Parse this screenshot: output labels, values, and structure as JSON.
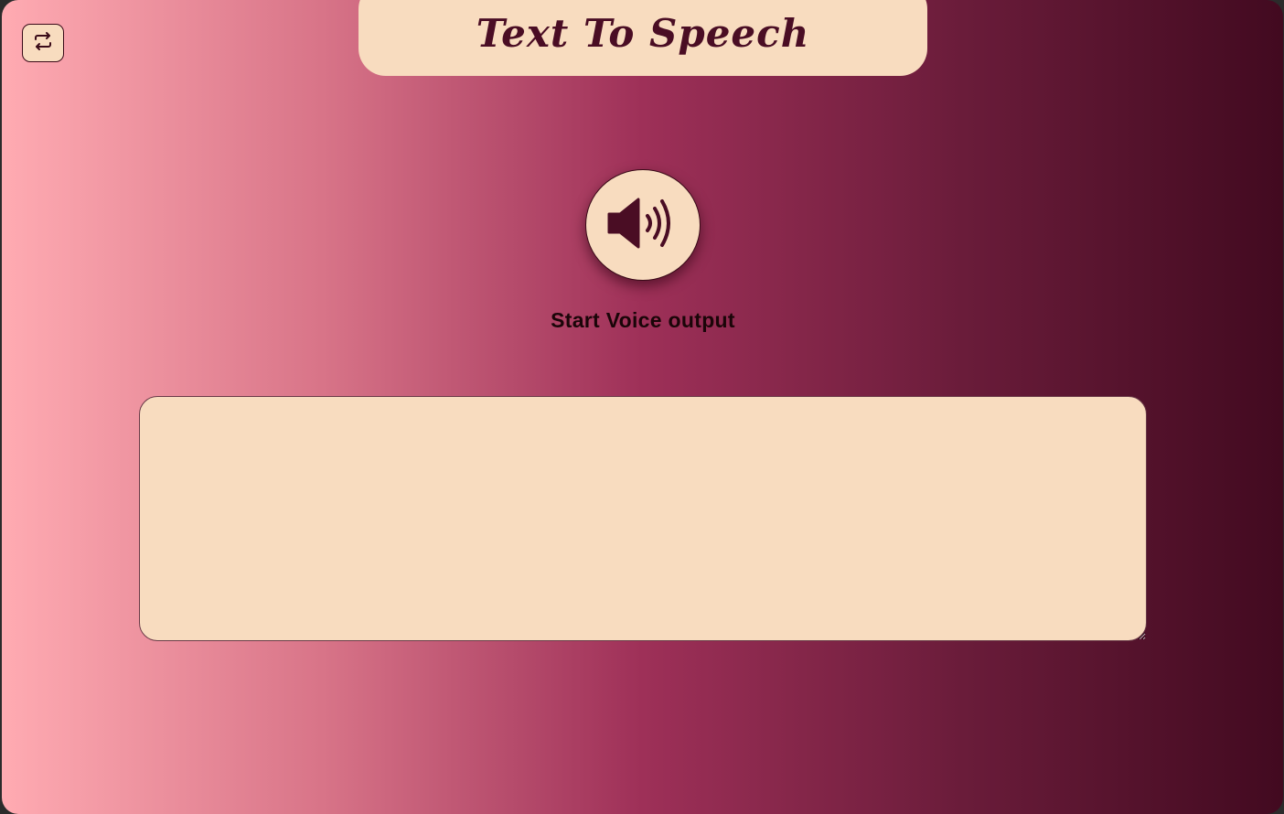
{
  "app": {
    "title": "Text To Speech"
  },
  "controls": {
    "swap_icon": "swap-arrows-icon",
    "speaker_icon": "speaker-volume-icon",
    "start_label": "Start Voice output"
  },
  "input": {
    "value": "",
    "placeholder": ""
  },
  "colors": {
    "panel": "#f8dcbf",
    "accent": "#4a0d24",
    "gradient_start": "#ffabb2",
    "gradient_end": "#420a20"
  }
}
